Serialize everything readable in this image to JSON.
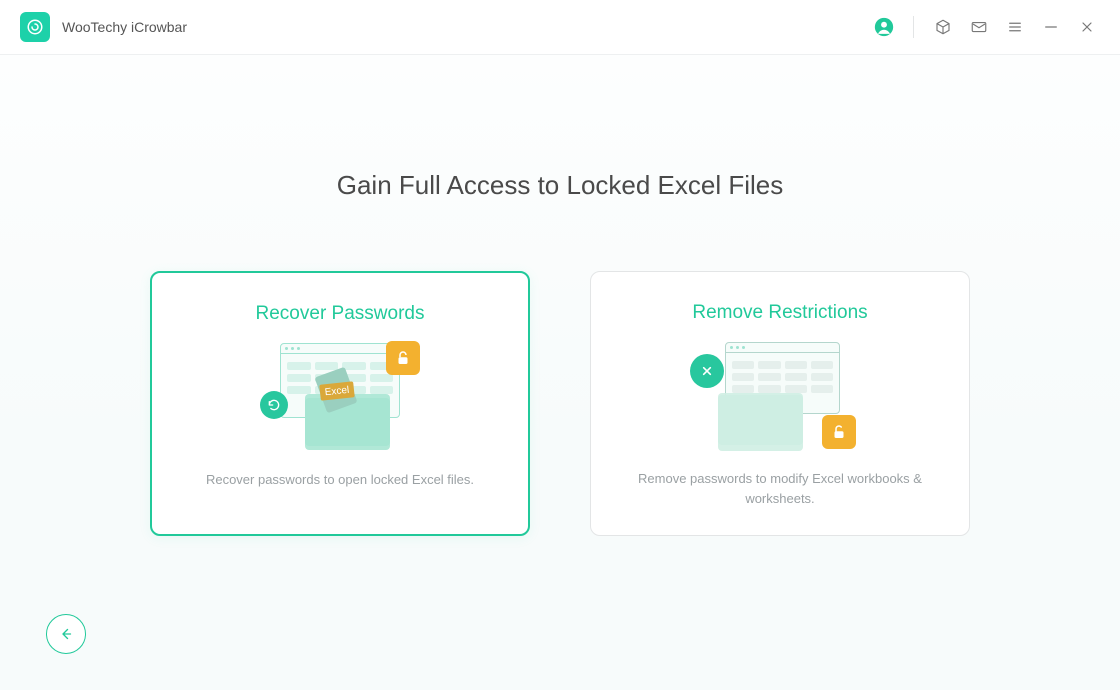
{
  "app": {
    "title": "WooTechy iCrowbar"
  },
  "header": {
    "title": "Gain Full Access to Locked Excel Files"
  },
  "cards": {
    "recover": {
      "title": "Recover Passwords",
      "desc": "Recover passwords to open locked Excel files.",
      "excel_tag": "Excel"
    },
    "restrict": {
      "title": "Remove Restrictions",
      "desc": "Remove passwords to modify Excel workbooks & worksheets."
    }
  }
}
